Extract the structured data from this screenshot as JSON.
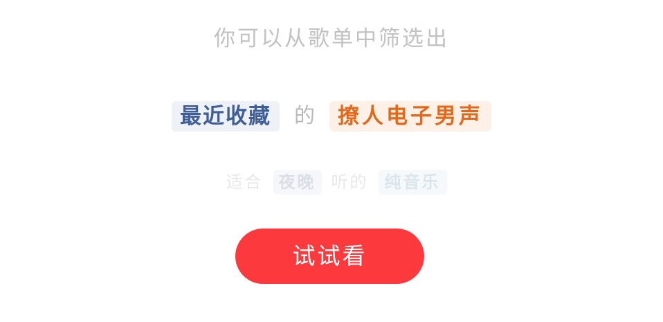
{
  "subtitle": "你可以从歌单中筛选出",
  "primary_filter": {
    "tag_left": "最近收藏",
    "connector": "的",
    "tag_right": "撩人电子男声",
    "colors": {
      "tag_left_text": "#3f5f96",
      "tag_left_bg": "#eef1f6",
      "tag_right_text": "#e3681a",
      "tag_right_bg": "#fdf1e7"
    }
  },
  "secondary_filter": {
    "prefix": "适合",
    "tag_time": "夜晚",
    "middle": "听的",
    "tag_genre": "纯音乐"
  },
  "cta": {
    "label": "试试看",
    "color": "#fc3a3e"
  }
}
